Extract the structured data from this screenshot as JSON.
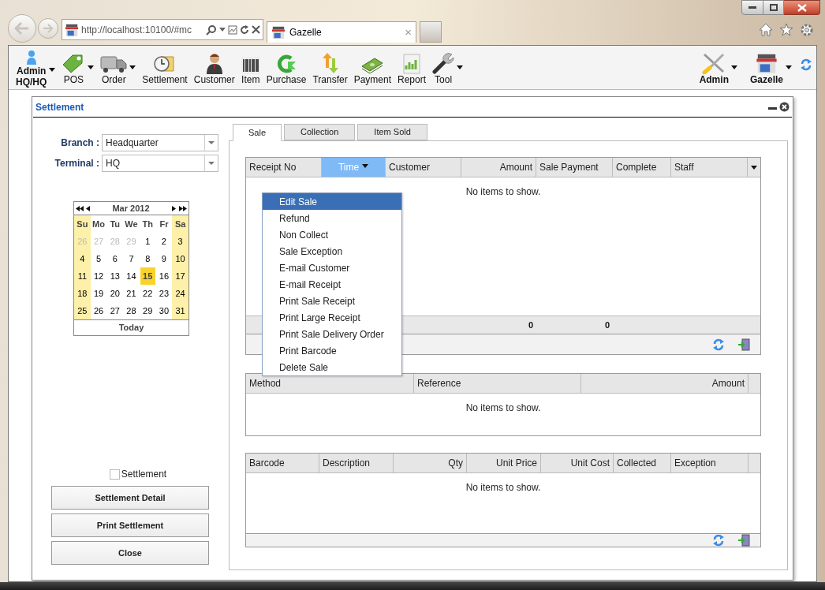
{
  "browser": {
    "address": "http://localhost:10100/#mc",
    "tab_title": "Gazelle",
    "tab_close": "×"
  },
  "toolbar": {
    "left_items": [
      {
        "kind": "user",
        "label": "Admin",
        "sublabel": "HQ/HQ",
        "dropdown": true
      },
      {
        "kind": "plain",
        "label": "POS",
        "dropdown": true
      },
      {
        "kind": "plain",
        "label": "Order",
        "dropdown": true
      },
      {
        "kind": "plain",
        "label": "Settlement",
        "dropdown": false
      },
      {
        "kind": "plain",
        "label": "Customer",
        "dropdown": false
      },
      {
        "kind": "plain",
        "label": "Item",
        "dropdown": false
      },
      {
        "kind": "plain",
        "label": "Purchase",
        "dropdown": false
      },
      {
        "kind": "plain",
        "label": "Transfer",
        "dropdown": false
      },
      {
        "kind": "plain",
        "label": "Payment",
        "dropdown": false
      },
      {
        "kind": "plain",
        "label": "Report",
        "dropdown": false
      },
      {
        "kind": "plain",
        "label": "Tool",
        "dropdown": true
      }
    ],
    "right_items": [
      {
        "label": "Admin",
        "dropdown": true
      },
      {
        "label": "Gazelle",
        "dropdown": true
      }
    ]
  },
  "window": {
    "title": "Settlement"
  },
  "filters": [
    {
      "label": "Branch :",
      "value": "Headquarter"
    },
    {
      "label": "Terminal :",
      "value": "HQ"
    }
  ],
  "calendar": {
    "month": "Mar 2012",
    "weekdays": [
      "Su",
      "Mo",
      "Tu",
      "We",
      "Th",
      "Fr",
      "Sa"
    ],
    "days": [
      {
        "label": "26",
        "other_month": true,
        "selected": false
      },
      {
        "label": "27",
        "other_month": true,
        "selected": false
      },
      {
        "label": "28",
        "other_month": true,
        "selected": false
      },
      {
        "label": "29",
        "other_month": true,
        "selected": false
      },
      {
        "label": "1",
        "other_month": false,
        "selected": false
      },
      {
        "label": "2",
        "other_month": false,
        "selected": false
      },
      {
        "label": "3",
        "other_month": false,
        "selected": false
      },
      {
        "label": "4",
        "other_month": false,
        "selected": false
      },
      {
        "label": "5",
        "other_month": false,
        "selected": false
      },
      {
        "label": "6",
        "other_month": false,
        "selected": false
      },
      {
        "label": "7",
        "other_month": false,
        "selected": false
      },
      {
        "label": "8",
        "other_month": false,
        "selected": false
      },
      {
        "label": "9",
        "other_month": false,
        "selected": false
      },
      {
        "label": "10",
        "other_month": false,
        "selected": false
      },
      {
        "label": "11",
        "other_month": false,
        "selected": false
      },
      {
        "label": "12",
        "other_month": false,
        "selected": false
      },
      {
        "label": "13",
        "other_month": false,
        "selected": false
      },
      {
        "label": "14",
        "other_month": false,
        "selected": false
      },
      {
        "label": "15",
        "other_month": false,
        "selected": true
      },
      {
        "label": "16",
        "other_month": false,
        "selected": false
      },
      {
        "label": "17",
        "other_month": false,
        "selected": false
      },
      {
        "label": "18",
        "other_month": false,
        "selected": false
      },
      {
        "label": "19",
        "other_month": false,
        "selected": false
      },
      {
        "label": "20",
        "other_month": false,
        "selected": false
      },
      {
        "label": "21",
        "other_month": false,
        "selected": false
      },
      {
        "label": "22",
        "other_month": false,
        "selected": false
      },
      {
        "label": "23",
        "other_month": false,
        "selected": false
      },
      {
        "label": "24",
        "other_month": false,
        "selected": false
      },
      {
        "label": "25",
        "other_month": false,
        "selected": false
      },
      {
        "label": "26",
        "other_month": false,
        "selected": false
      },
      {
        "label": "27",
        "other_month": false,
        "selected": false
      },
      {
        "label": "28",
        "other_month": false,
        "selected": false
      },
      {
        "label": "29",
        "other_month": false,
        "selected": false
      },
      {
        "label": "30",
        "other_month": false,
        "selected": false
      },
      {
        "label": "31",
        "other_month": false,
        "selected": false
      }
    ],
    "today_button": "Today"
  },
  "settlement_checkbox": {
    "label": "Settlement",
    "checked": false
  },
  "buttons": [
    "Settlement Detail",
    "Print Settlement",
    "Close"
  ],
  "tabs": [
    {
      "label": "Sale",
      "selected": true
    },
    {
      "label": "Collection",
      "selected": false
    },
    {
      "label": "Item Sold",
      "selected": false
    }
  ],
  "sale_grid": {
    "columns": [
      {
        "label": "Receipt No",
        "active": false
      },
      {
        "label": "Time",
        "active": true
      },
      {
        "label": "Customer",
        "active": false
      },
      {
        "label": "Amount",
        "active": false,
        "total": "0"
      },
      {
        "label": "Sale Payment",
        "active": false,
        "total": "0"
      },
      {
        "label": "Complete",
        "active": false
      },
      {
        "label": "Staff",
        "active": false
      }
    ],
    "empty_text": "No items to show."
  },
  "context_menu": {
    "items": [
      {
        "label": "Edit Sale",
        "selected": true
      },
      {
        "label": "Refund",
        "selected": false
      },
      {
        "label": "Non Collect",
        "selected": false
      },
      {
        "label": "Sale Exception",
        "selected": false
      },
      {
        "label": "E-mail Customer",
        "selected": false
      },
      {
        "label": "E-mail Receipt",
        "selected": false
      },
      {
        "label": "Print Sale Receipt",
        "selected": false
      },
      {
        "label": "Print Large Receipt",
        "selected": false
      },
      {
        "label": "Print Sale Delivery Order",
        "selected": false
      },
      {
        "label": "Print Barcode",
        "selected": false
      },
      {
        "label": "Delete Sale",
        "selected": false
      }
    ]
  },
  "collection_grid": {
    "columns": [
      {
        "label": "Method"
      },
      {
        "label": "Reference"
      },
      {
        "label": "Amount"
      }
    ],
    "empty_text": "No items to show."
  },
  "item_grid": {
    "columns": [
      {
        "label": "Barcode"
      },
      {
        "label": "Description"
      },
      {
        "label": "Qty"
      },
      {
        "label": "Unit Price"
      },
      {
        "label": "Unit Cost"
      },
      {
        "label": "Collected"
      },
      {
        "label": "Exception"
      }
    ],
    "empty_text": "No items to show."
  }
}
